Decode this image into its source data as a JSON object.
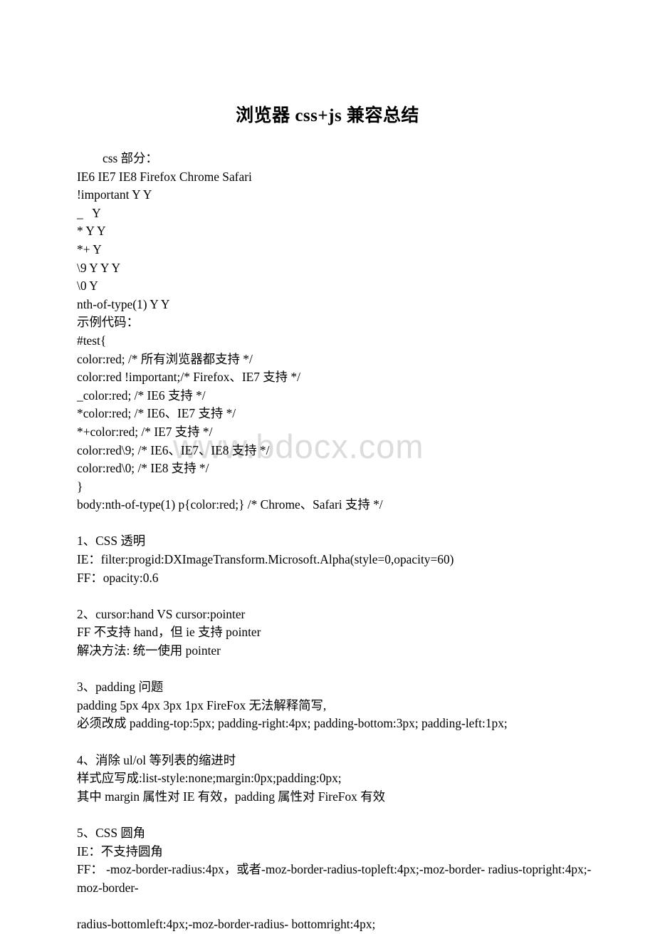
{
  "document": {
    "title": "浏览器 css+js 兼容总结",
    "watermark": "www.bdocx.com"
  },
  "lines": [
    {
      "text": "css 部分：",
      "indent": true
    },
    {
      "text": "IE6 IE7 IE8 Firefox Chrome Safari"
    },
    {
      "text": "!important Y Y"
    },
    {
      "text": "_   Y"
    },
    {
      "text": "* Y Y"
    },
    {
      "text": "*+ Y"
    },
    {
      "text": "\\9 Y Y Y"
    },
    {
      "text": "\\0 Y"
    },
    {
      "text": "nth-of-type(1) Y Y"
    },
    {
      "text": "示例代码："
    },
    {
      "text": "#test{"
    },
    {
      "text": "color:red; /* 所有浏览器都支持 */"
    },
    {
      "text": "color:red !important;/* Firefox、IE7 支持 */"
    },
    {
      "text": "_color:red; /* IE6 支持 */"
    },
    {
      "text": "*color:red; /* IE6、IE7 支持 */"
    },
    {
      "text": "*+color:red; /* IE7 支持 */"
    },
    {
      "text": "color:red\\9; /* IE6、IE7、IE8 支持 */"
    },
    {
      "text": "color:red\\0; /* IE8 支持 */"
    },
    {
      "text": "}"
    },
    {
      "text": "body:nth-of-type(1) p{color:red;} /* Chrome、Safari 支持 */"
    },
    {
      "text": "",
      "blank": true
    },
    {
      "text": "1、CSS 透明"
    },
    {
      "text": "IE：filter:progid:DXImageTransform.Microsoft.Alpha(style=0,opacity=60)"
    },
    {
      "text": "FF：opacity:0.6"
    },
    {
      "text": "",
      "blank": true
    },
    {
      "text": "2、cursor:hand VS cursor:pointer"
    },
    {
      "text": "FF 不支持 hand，但 ie 支持 pointer"
    },
    {
      "text": "解决方法: 统一使用 pointer"
    },
    {
      "text": "",
      "blank": true
    },
    {
      "text": "3、padding 问题"
    },
    {
      "text": "padding 5px 4px 3px 1px FireFox 无法解释简写,"
    },
    {
      "text": "必须改成 padding-top:5px; padding-right:4px; padding-bottom:3px; padding-left:1px;"
    },
    {
      "text": "",
      "blank": true
    },
    {
      "text": "4、消除 ul/ol 等列表的缩进时"
    },
    {
      "text": "样式应写成:list-style:none;margin:0px;padding:0px;"
    },
    {
      "text": "其中 margin 属性对 IE 有效，padding 属性对 FireFox 有效"
    },
    {
      "text": "",
      "blank": true
    },
    {
      "text": "5、CSS 圆角"
    },
    {
      "text": "IE：不支持圆角"
    },
    {
      "text": "FF： -moz-border-radius:4px，或者-moz-border-radius-topleft:4px;-moz-border- radius-topright:4px;-moz-border-"
    },
    {
      "text": "",
      "blank": true
    },
    {
      "text": "radius-bottomleft:4px;-moz-border-radius- bottomright:4px;"
    }
  ]
}
